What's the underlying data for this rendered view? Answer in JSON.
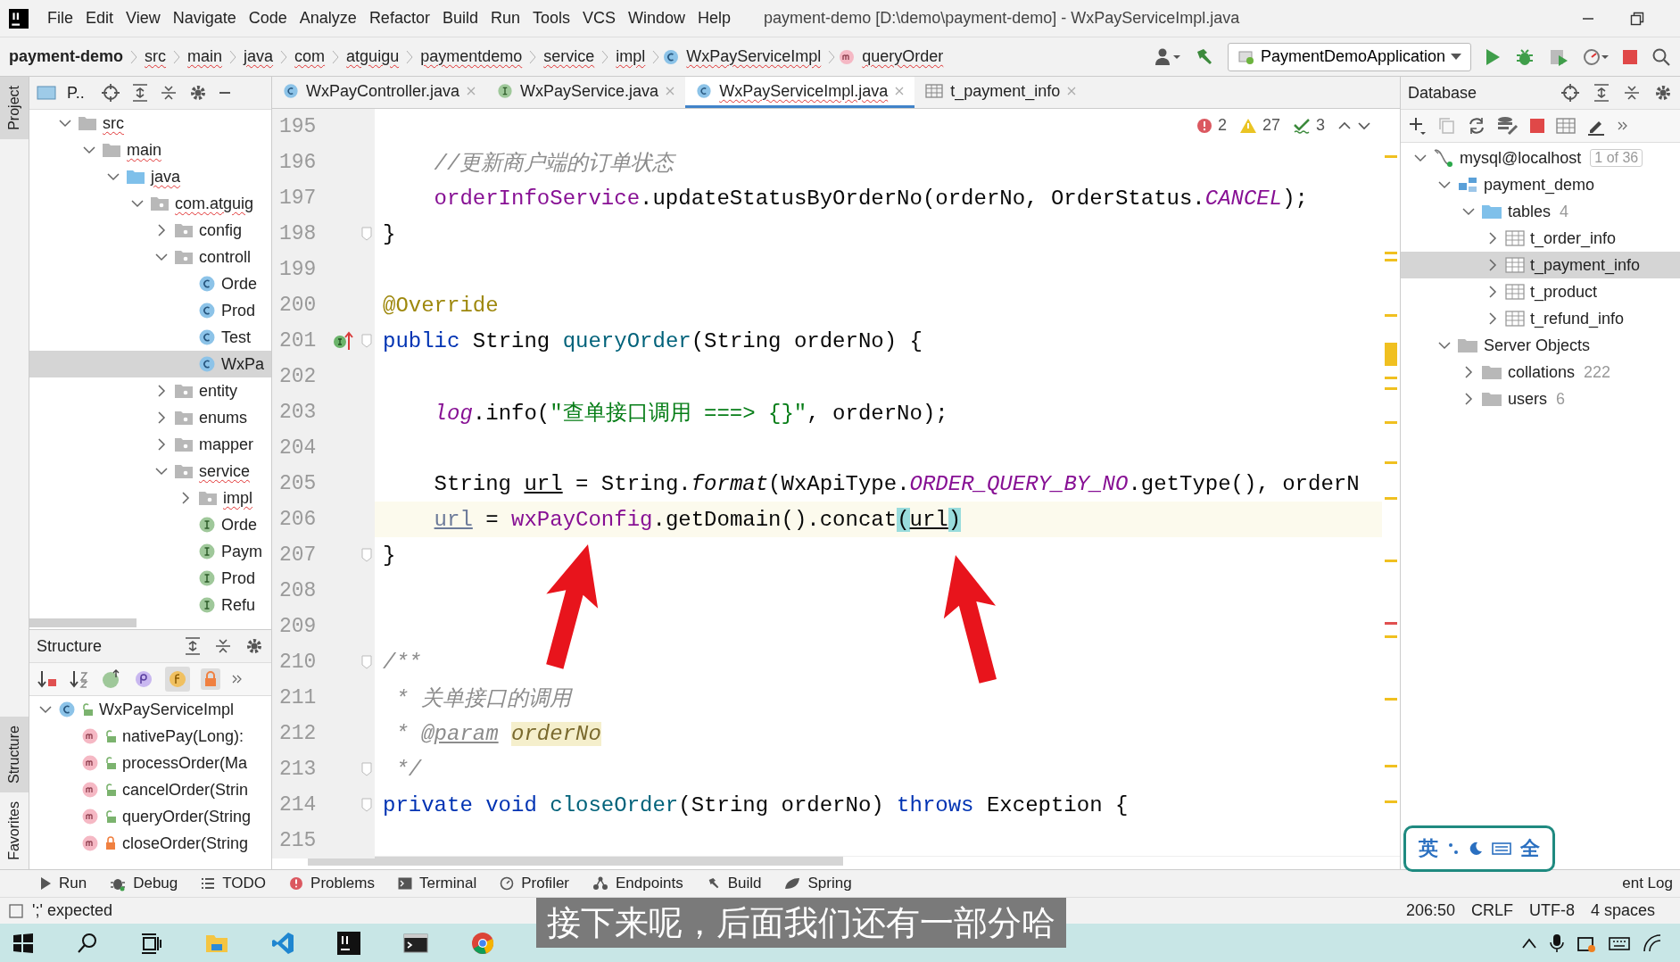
{
  "menu_items": [
    "File",
    "Edit",
    "View",
    "Navigate",
    "Code",
    "Analyze",
    "Refactor",
    "Build",
    "Run",
    "Tools",
    "VCS",
    "Window",
    "Help"
  ],
  "window_title": "payment-demo [D:\\demo\\payment-demo] - WxPayServiceImpl.java",
  "breadcrumbs": [
    {
      "label": "payment-demo",
      "kind": "project",
      "squiggle": false
    },
    {
      "label": "src",
      "kind": "folder",
      "squiggle": true
    },
    {
      "label": "main",
      "kind": "folder",
      "squiggle": true
    },
    {
      "label": "java",
      "kind": "folder",
      "squiggle": true
    },
    {
      "label": "com",
      "kind": "folder",
      "squiggle": true
    },
    {
      "label": "atguigu",
      "kind": "folder",
      "squiggle": true
    },
    {
      "label": "paymentdemo",
      "kind": "folder",
      "squiggle": true
    },
    {
      "label": "service",
      "kind": "folder",
      "squiggle": true
    },
    {
      "label": "impl",
      "kind": "folder",
      "squiggle": true
    },
    {
      "label": "WxPayServiceImpl",
      "kind": "class",
      "squiggle": true
    },
    {
      "label": "queryOrder",
      "kind": "method",
      "squiggle": true
    }
  ],
  "run_config": {
    "label": "PaymentDemoApplication"
  },
  "editor_tabs": [
    {
      "label": "WxPayController.java",
      "kind": "class",
      "selected": false
    },
    {
      "label": "WxPayService.java",
      "kind": "interface",
      "selected": false
    },
    {
      "label": "WxPayServiceImpl.java",
      "kind": "class",
      "selected": true
    },
    {
      "label": "t_payment_info",
      "kind": "table",
      "selected": false
    }
  ],
  "project": {
    "title": "P..",
    "tree": [
      {
        "label": "src",
        "kind": "folder",
        "expanded": true,
        "selected": false,
        "squiggle": true,
        "children": [
          {
            "label": "main",
            "kind": "folder",
            "expanded": true,
            "selected": false,
            "squiggle": true,
            "children": [
              {
                "label": "java",
                "kind": "source",
                "expanded": true,
                "selected": false,
                "squiggle": true,
                "children": [
                  {
                    "label": "com.atguig",
                    "kind": "package",
                    "expanded": true,
                    "selected": false,
                    "squiggle": true,
                    "children": [
                      {
                        "label": "config",
                        "kind": "package",
                        "expanded": false,
                        "selected": false,
                        "squiggle": false
                      },
                      {
                        "label": "controll",
                        "kind": "package",
                        "expanded": true,
                        "selected": false,
                        "squiggle": false,
                        "children": [
                          {
                            "label": "Orde",
                            "kind": "class",
                            "selected": false,
                            "squiggle": false
                          },
                          {
                            "label": "Prod",
                            "kind": "class",
                            "selected": false,
                            "squiggle": false
                          },
                          {
                            "label": "Test",
                            "kind": "class",
                            "selected": false,
                            "squiggle": false
                          },
                          {
                            "label": "WxPa",
                            "kind": "class",
                            "selected": true,
                            "squiggle": false
                          }
                        ]
                      },
                      {
                        "label": "entity",
                        "kind": "package",
                        "expanded": false,
                        "selected": false,
                        "squiggle": false
                      },
                      {
                        "label": "enums",
                        "kind": "package",
                        "expanded": false,
                        "selected": false,
                        "squiggle": false
                      },
                      {
                        "label": "mapper",
                        "kind": "package",
                        "expanded": false,
                        "selected": false,
                        "squiggle": false
                      },
                      {
                        "label": "service",
                        "kind": "package",
                        "expanded": true,
                        "selected": false,
                        "squiggle": true,
                        "children": [
                          {
                            "label": "impl",
                            "kind": "package",
                            "expanded": false,
                            "selected": false,
                            "squiggle": true
                          },
                          {
                            "label": "Orde",
                            "kind": "interface",
                            "selected": false,
                            "squiggle": false
                          },
                          {
                            "label": "Paym",
                            "kind": "interface",
                            "selected": false,
                            "squiggle": false
                          },
                          {
                            "label": "Prod",
                            "kind": "interface",
                            "selected": false,
                            "squiggle": false
                          },
                          {
                            "label": "Refu",
                            "kind": "interface",
                            "selected": false,
                            "squiggle": false
                          }
                        ]
                      }
                    ]
                  }
                ]
              }
            ]
          }
        ]
      }
    ]
  },
  "structure": {
    "title": "Structure",
    "tree": [
      {
        "label": "WxPayServiceImpl",
        "kind": "class",
        "locked": false,
        "expanded": true,
        "children": [
          {
            "label": "nativePay(Long):",
            "kind": "method",
            "locked": false
          },
          {
            "label": "processOrder(Ma",
            "kind": "method",
            "locked": false
          },
          {
            "label": "cancelOrder(Strin",
            "kind": "method",
            "locked": false
          },
          {
            "label": "queryOrder(String",
            "kind": "method",
            "locked": false
          },
          {
            "label": "closeOrder(String",
            "kind": "method",
            "locked": true
          }
        ]
      }
    ]
  },
  "editor": {
    "inspections": {
      "errors": "2",
      "warnings": "27",
      "typos": "3"
    },
    "lines": [
      {
        "number": "195",
        "current": false,
        "fold": false
      },
      {
        "number": "196",
        "current": false,
        "fold": false,
        "tokens": [
          {
            "text": "    //更新商户端的订单状态",
            "kind": "comment"
          }
        ]
      },
      {
        "number": "197",
        "current": false,
        "fold": false,
        "tokens": [
          {
            "text": "    orderInfoService",
            "kind": "field"
          },
          {
            "text": ".updateStatusByOrderNo(orderNo, OrderStatus.",
            "kind": "plain"
          },
          {
            "text": "CANCEL",
            "kind": "static_field"
          },
          {
            "text": ");",
            "kind": "plain"
          }
        ]
      },
      {
        "number": "198",
        "current": false,
        "fold": true,
        "tokens": [
          {
            "text": "}",
            "kind": "plain"
          }
        ]
      },
      {
        "number": "199",
        "current": false,
        "fold": false
      },
      {
        "number": "200",
        "current": false,
        "fold": false,
        "tokens": [
          {
            "text": "@Override",
            "kind": "annotation"
          }
        ]
      },
      {
        "number": "201",
        "current": false,
        "fold": true,
        "implements_marker": true,
        "tokens": [
          {
            "text": "public ",
            "kind": "keyword"
          },
          {
            "text": "String ",
            "kind": "plain"
          },
          {
            "text": "queryOrder",
            "kind": "method_decl"
          },
          {
            "text": "(String orderNo) {",
            "kind": "plain"
          }
        ]
      },
      {
        "number": "202",
        "current": false,
        "fold": false
      },
      {
        "number": "203",
        "current": false,
        "fold": false,
        "tokens": [
          {
            "text": "    log",
            "kind": "static_field"
          },
          {
            "text": ".info(",
            "kind": "plain"
          },
          {
            "text": "\"查单接口调用 ===> {}\"",
            "kind": "string"
          },
          {
            "text": ", orderNo);",
            "kind": "plain"
          }
        ]
      },
      {
        "number": "204",
        "current": false,
        "fold": false
      },
      {
        "number": "205",
        "current": false,
        "fold": false,
        "tokens": [
          {
            "text": "    String ",
            "kind": "plain"
          },
          {
            "text": "url",
            "kind": "reassigned"
          },
          {
            "text": " = String.",
            "kind": "plain"
          },
          {
            "text": "format",
            "kind": "static_call"
          },
          {
            "text": "(WxApiType.",
            "kind": "plain"
          },
          {
            "text": "ORDER_QUERY_BY_NO",
            "kind": "static_field"
          },
          {
            "text": ".getType(), orderN",
            "kind": "plain"
          }
        ]
      },
      {
        "number": "206",
        "current": true,
        "fold": false,
        "tokens": [
          {
            "text": "    url",
            "kind": "reassigned_dim"
          },
          {
            "text": " = ",
            "kind": "plain"
          },
          {
            "text": "wxPayConfig",
            "kind": "field"
          },
          {
            "text": ".getDomain().concat",
            "kind": "plain"
          },
          {
            "text": "(",
            "kind": "brace_match"
          },
          {
            "text": "url",
            "kind": "reassigned"
          },
          {
            "text": ")",
            "kind": "brace_match"
          }
        ]
      },
      {
        "number": "207",
        "current": false,
        "fold": true,
        "tokens": [
          {
            "text": "}",
            "kind": "plain"
          }
        ]
      },
      {
        "number": "208",
        "current": false,
        "fold": false
      },
      {
        "number": "209",
        "current": false,
        "fold": false
      },
      {
        "number": "210",
        "current": false,
        "fold": true,
        "tokens": [
          {
            "text": "/**",
            "kind": "doc"
          }
        ]
      },
      {
        "number": "211",
        "current": false,
        "fold": false,
        "tokens": [
          {
            "text": " * 关单接口的调用",
            "kind": "doc"
          }
        ]
      },
      {
        "number": "212",
        "current": false,
        "fold": false,
        "tokens": [
          {
            "text": " * ",
            "kind": "doc"
          },
          {
            "text": "@param",
            "kind": "doc_tag"
          },
          {
            "text": "orderNo",
            "kind": "doc_param"
          }
        ]
      },
      {
        "number": "213",
        "current": false,
        "fold": true,
        "tokens": [
          {
            "text": " */",
            "kind": "doc"
          }
        ]
      },
      {
        "number": "214",
        "current": false,
        "fold": true,
        "tokens": [
          {
            "text": "private void ",
            "kind": "keyword"
          },
          {
            "text": "closeOrder",
            "kind": "method_decl"
          },
          {
            "text": "(String orderNo) ",
            "kind": "plain"
          },
          {
            "text": "throws ",
            "kind": "keyword"
          },
          {
            "text": "Exception {",
            "kind": "plain"
          }
        ]
      },
      {
        "number": "215",
        "current": false,
        "fold": false
      }
    ]
  },
  "database": {
    "title": "Database",
    "tree": [
      {
        "label": "mysql@localhost",
        "kind": "connection",
        "badge": "1 of 36",
        "expanded": true,
        "selected": false,
        "children": [
          {
            "label": "payment_demo",
            "kind": "schema",
            "expanded": true,
            "selected": false,
            "children": [
              {
                "label": "tables",
                "kind": "folder_blue",
                "count": "4",
                "expanded": true,
                "selected": false,
                "children": [
                  {
                    "label": "t_order_info",
                    "kind": "table",
                    "expanded": false,
                    "selected": false
                  },
                  {
                    "label": "t_payment_info",
                    "kind": "table",
                    "expanded": false,
                    "selected": true
                  },
                  {
                    "label": "t_product",
                    "kind": "table",
                    "expanded": false,
                    "selected": false
                  },
                  {
                    "label": "t_refund_info",
                    "kind": "table",
                    "expanded": false,
                    "selected": false
                  }
                ]
              }
            ]
          },
          {
            "label": "Server Objects",
            "kind": "folder",
            "expanded": true,
            "selected": false,
            "children": [
              {
                "label": "collations",
                "kind": "folder",
                "count": "222",
                "expanded": false,
                "selected": false
              },
              {
                "label": "users",
                "kind": "folder",
                "count": "6",
                "expanded": false,
                "selected": false
              }
            ]
          }
        ]
      }
    ]
  },
  "tool_windows": [
    {
      "label": "Run",
      "kind": "run"
    },
    {
      "label": "Debug",
      "kind": "debug"
    },
    {
      "label": "TODO",
      "kind": "todo"
    },
    {
      "label": "Problems",
      "kind": "problems"
    },
    {
      "label": "Terminal",
      "kind": "terminal"
    },
    {
      "label": "Profiler",
      "kind": "profiler"
    },
    {
      "label": "Endpoints",
      "kind": "endpoints"
    },
    {
      "label": "Build",
      "kind": "build"
    },
    {
      "label": "Spring",
      "kind": "spring"
    },
    {
      "label": "ent Log",
      "kind": "log"
    }
  ],
  "status_bar": {
    "message": "';' expected",
    "items": [
      "206:50",
      "CRLF",
      "UTF-8",
      "4 spaces"
    ]
  },
  "side_labels": {
    "project": "Project",
    "structure": "Structure",
    "favorites": "Favorites"
  },
  "subtitle": "接下来呢，后面我们还有一部分哈",
  "ime": {
    "language": "英",
    "width": "全"
  }
}
